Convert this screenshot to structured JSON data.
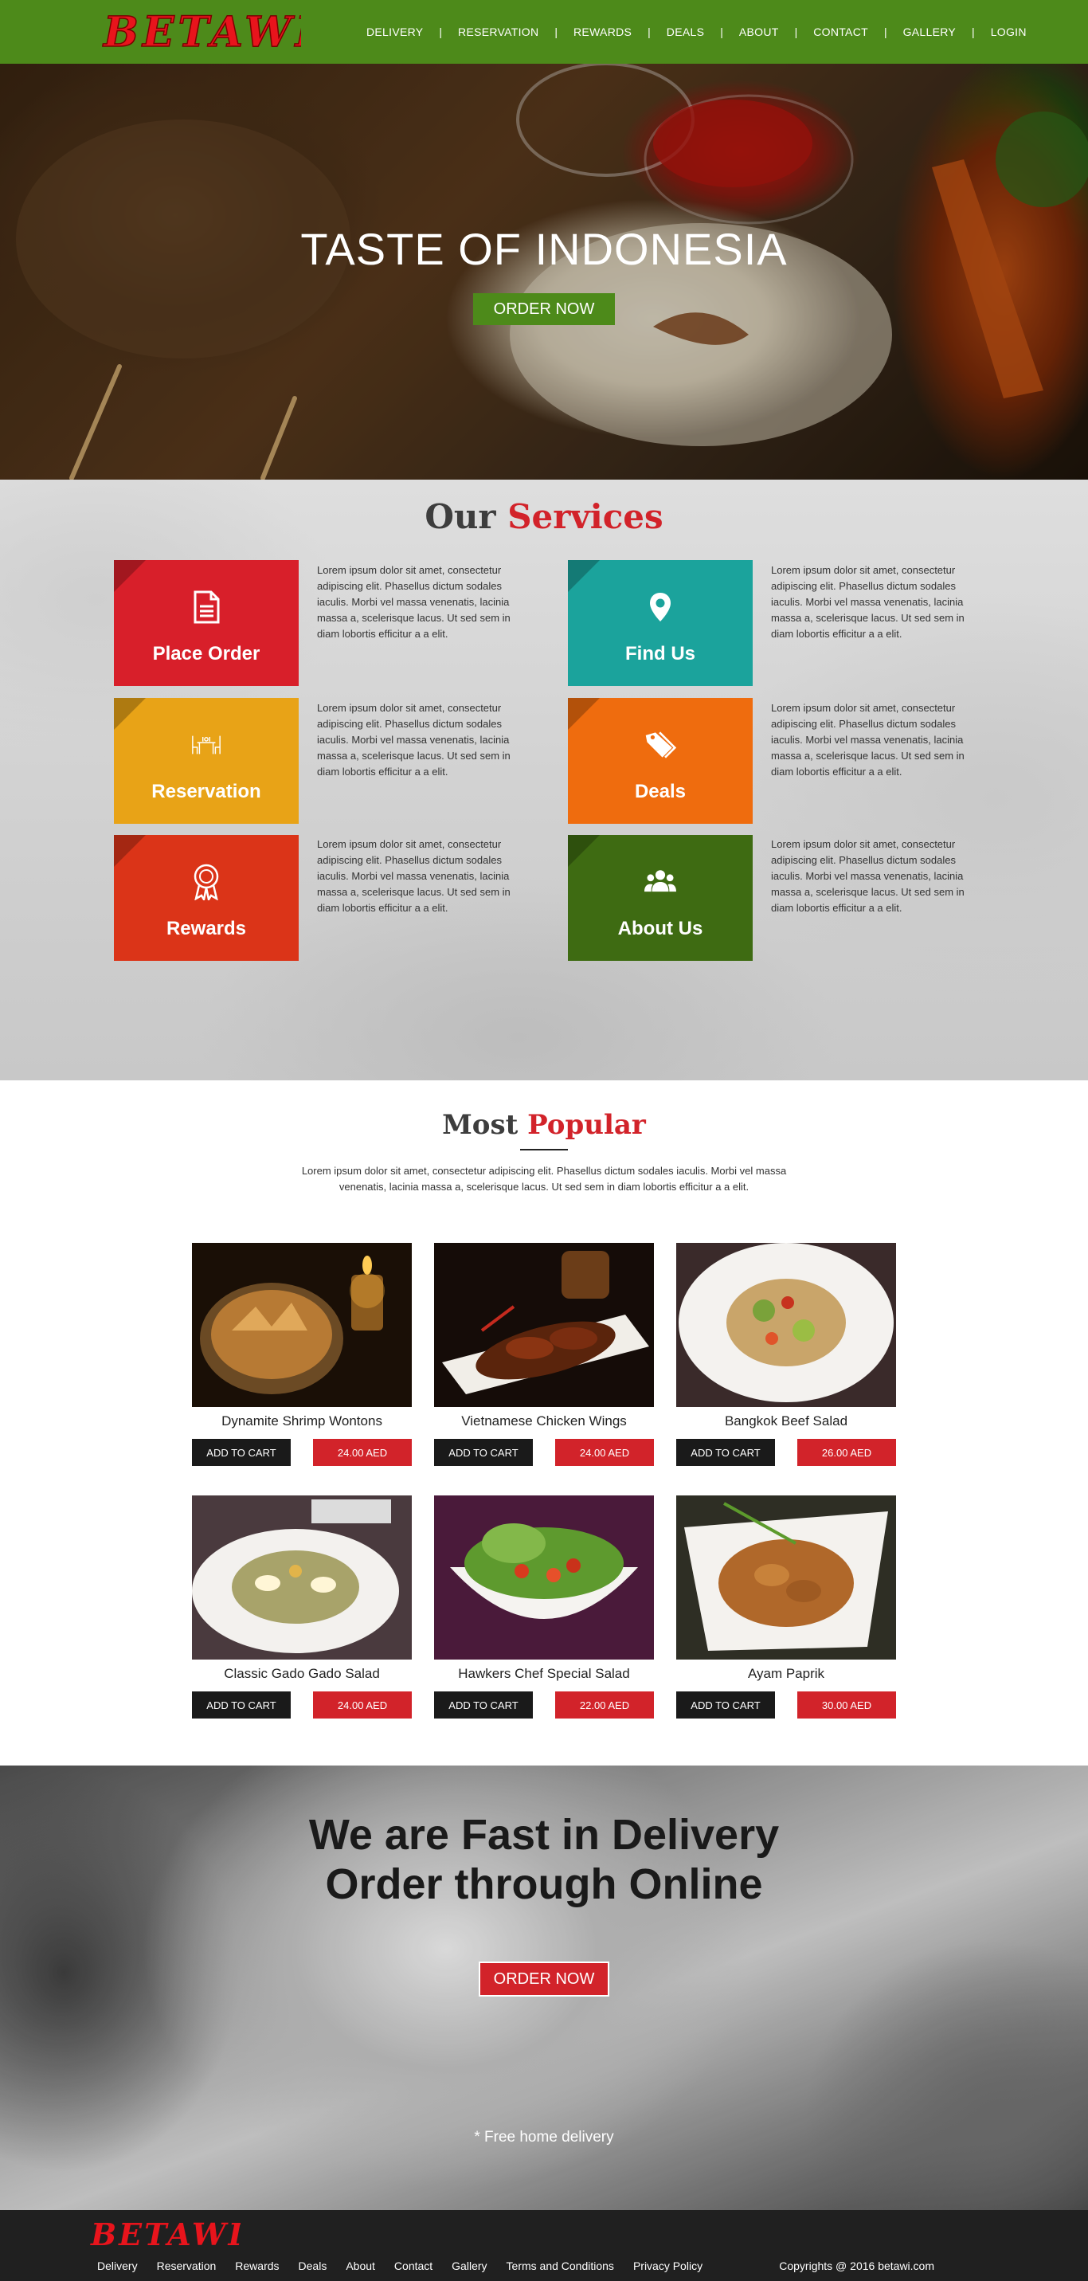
{
  "header": {
    "logo_text": "BETAWI",
    "nav": [
      "DELIVERY",
      "RESERVATION",
      "REWARDS",
      "DEALS",
      "ABOUT",
      "CONTACT",
      "GALLERY",
      "LOGIN"
    ],
    "separator": "|"
  },
  "hero": {
    "title": "TASTE OF INDONESIA",
    "button": "ORDER NOW"
  },
  "services": {
    "title_part1": "Our",
    "title_part2": "Services",
    "items": [
      {
        "label": "Place Order",
        "icon": "document-icon",
        "color": "#d81f2a",
        "text": "Lorem ipsum dolor sit amet, consectetur adipiscing elit. Phasellus dictum sodales iaculis. Morbi vel massa venenatis, lacinia massa a, scelerisque lacus. Ut sed sem in diam lobortis efficitur a a elit."
      },
      {
        "label": "Find Us",
        "icon": "map-pin-icon",
        "color": "#1ba39c",
        "text": "Lorem ipsum dolor sit amet, consectetur adipiscing elit. Phasellus dictum sodales iaculis. Morbi vel massa venenatis, lacinia massa a, scelerisque lacus. Ut sed sem in diam lobortis efficitur a a elit."
      },
      {
        "label": "Reservation",
        "icon": "dining-table-icon",
        "color": "#e8a317",
        "text": "Lorem ipsum dolor sit amet, consectetur adipiscing elit. Phasellus dictum sodales iaculis. Morbi vel massa venenatis, lacinia massa a, scelerisque lacus. Ut sed sem in diam lobortis efficitur a a elit."
      },
      {
        "label": "Deals",
        "icon": "tags-icon",
        "color": "#ef6c0e",
        "text": "Lorem ipsum dolor sit amet, consectetur adipiscing elit. Phasellus dictum sodales iaculis. Morbi vel massa venenatis, lacinia massa a, scelerisque lacus. Ut sed sem in diam lobortis efficitur a a elit."
      },
      {
        "label": "Rewards",
        "icon": "award-ribbon-icon",
        "color": "#db3418",
        "text": "Lorem ipsum dolor sit amet, consectetur adipiscing elit. Phasellus dictum sodales iaculis. Morbi vel massa venenatis, lacinia massa a, scelerisque lacus. Ut sed sem in diam lobortis efficitur a a elit."
      },
      {
        "label": "About Us",
        "icon": "users-icon",
        "color": "#3e6b12",
        "text": "Lorem ipsum dolor sit amet, consectetur adipiscing elit. Phasellus dictum sodales iaculis. Morbi vel massa venenatis, lacinia massa a, scelerisque lacus. Ut sed sem in diam lobortis efficitur a a elit."
      }
    ]
  },
  "popular": {
    "title_part1": "Most",
    "title_part2": "Popular",
    "description": "Lorem ipsum dolor sit amet, consectetur adipiscing elit. Phasellus dictum sodales iaculis. Morbi vel massa venenatis, lacinia massa a, scelerisque lacus. Ut sed sem in diam lobortis efficitur a a elit.",
    "add_to_cart": "ADD TO CART",
    "items": [
      {
        "name": "Dynamite Shrimp Wontons",
        "price": "24.00 AED"
      },
      {
        "name": "Vietnamese Chicken Wings",
        "price": "24.00 AED"
      },
      {
        "name": "Bangkok Beef Salad",
        "price": "26.00 AED"
      },
      {
        "name": "Classic Gado Gado Salad",
        "price": "24.00 AED"
      },
      {
        "name": "Hawkers Chef Special Salad",
        "price": "22.00 AED"
      },
      {
        "name": "Ayam Paprik",
        "price": "30.00 AED"
      }
    ]
  },
  "delivery": {
    "title_line1": "We are Fast in Delivery",
    "title_line2": "Order through Online",
    "button": "ORDER NOW",
    "note": "* Free home delivery"
  },
  "footer": {
    "logo_text": "BETAWI",
    "links": [
      "Delivery",
      "Reservation",
      "Rewards",
      "Deals",
      "About",
      "Contact",
      "Gallery",
      "Terms and Conditions",
      "Privacy Policy"
    ],
    "copyright": "Copyrights @ 2016 betawi.com"
  }
}
